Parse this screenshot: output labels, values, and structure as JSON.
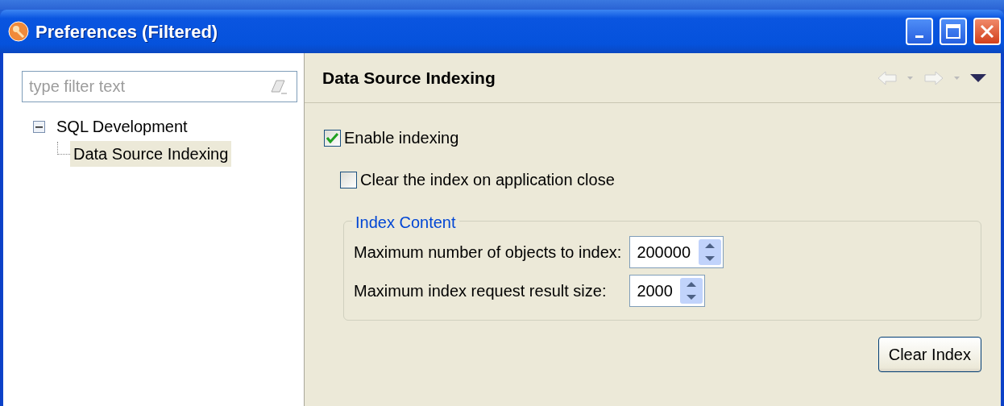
{
  "window": {
    "title": "Preferences (Filtered)"
  },
  "filter": {
    "placeholder": "type filter text"
  },
  "tree": [
    {
      "label": "SQL Development",
      "expanded": true,
      "selected": false,
      "children": [
        {
          "label": "Data Source Indexing",
          "selected": true
        }
      ]
    }
  ],
  "page": {
    "title": "Data Source Indexing"
  },
  "options": [
    {
      "label": "Enable indexing",
      "checked": true,
      "children": [
        {
          "label": "Clear the index on application close",
          "checked": false
        }
      ]
    }
  ],
  "group": {
    "title": "Index Content",
    "fields": [
      {
        "label": "Maximum number of objects to index:",
        "value": "200000"
      },
      {
        "label": "Maximum index request result size:",
        "value": "2000"
      }
    ]
  },
  "buttons": [
    {
      "label": "Clear Index"
    }
  ]
}
